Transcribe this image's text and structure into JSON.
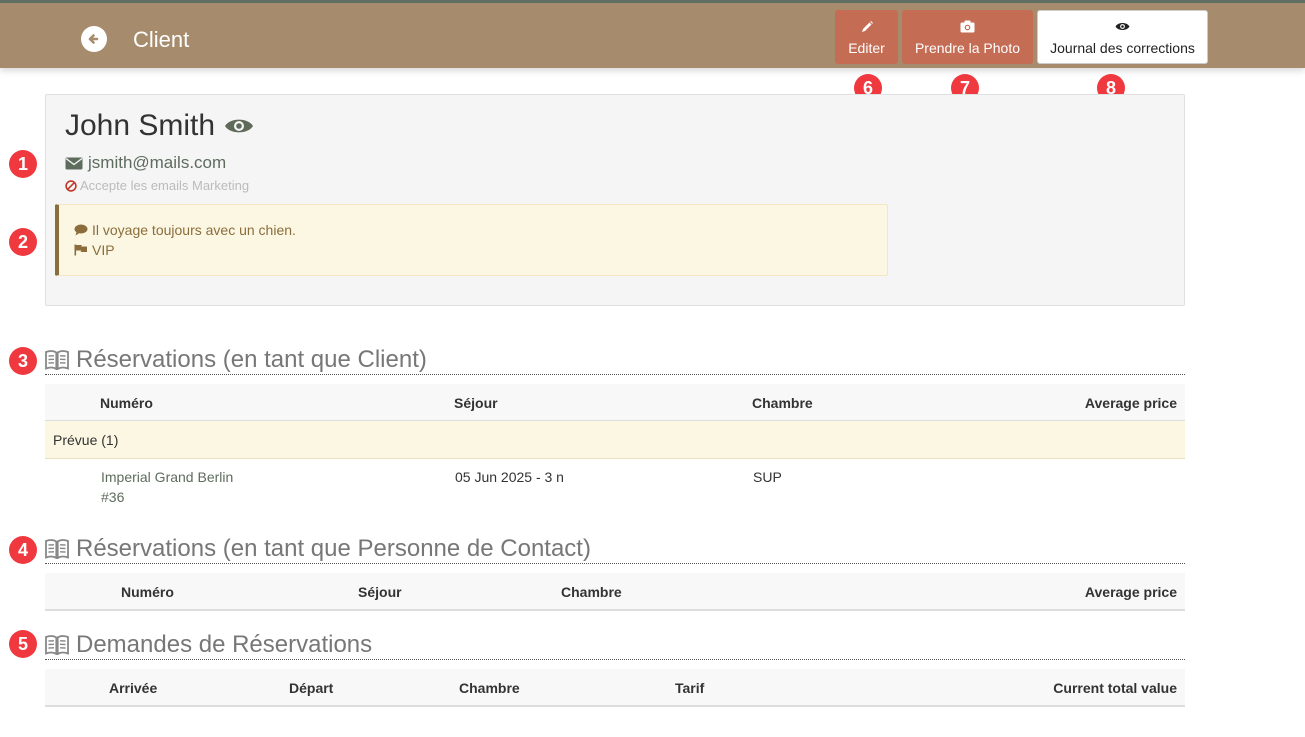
{
  "header": {
    "title": "Client",
    "buttons": {
      "edit": "Editer",
      "photo": "Prendre la Photo",
      "log": "Journal des corrections"
    }
  },
  "markers": [
    "1",
    "2",
    "3",
    "4",
    "5",
    "6",
    "7",
    "8"
  ],
  "client": {
    "name": "John Smith",
    "email": "jsmith@mails.com",
    "marketing": "Accepte les emails Marketing",
    "notes": [
      {
        "icon": "comment-icon",
        "text": "Il voyage toujours avec un chien."
      },
      {
        "icon": "flag-icon",
        "text": "VIP"
      }
    ]
  },
  "sections": {
    "client_reservations": {
      "title": "Réservations (en tant que Client)",
      "columns": [
        "Numéro",
        "Séjour",
        "Chambre",
        "Average price"
      ],
      "group": "Prévue (1)",
      "rows": [
        {
          "hotel": "Imperial Grand Berlin",
          "number": "#36",
          "stay": "05 Jun 2025 - 3 n",
          "room": "SUP",
          "avg_price": ""
        }
      ]
    },
    "contact_reservations": {
      "title": "Réservations (en tant que Personne de Contact)",
      "columns": [
        "Numéro",
        "Séjour",
        "Chambre",
        "Average price"
      ]
    },
    "requests": {
      "title": "Demandes de Réservations",
      "columns": [
        "Arrivée",
        "Départ",
        "Chambre",
        "Tarif",
        "Current total value"
      ]
    }
  },
  "colors": {
    "header_bg": "#a68c6c",
    "accent_button": "#c46c54",
    "marker_red": "#f0393f",
    "note_bg": "#fcf7e3",
    "note_text": "#8a6d3b"
  }
}
